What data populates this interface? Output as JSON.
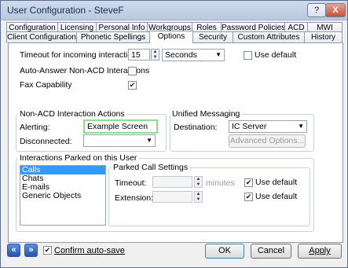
{
  "window": {
    "title": "User Configuration - SteveF",
    "help_label": "?",
    "close_label": "X"
  },
  "tabs_row1": [
    "Configuration",
    "Licensing",
    "Personal Info",
    "Workgroups",
    "Roles",
    "Password Policies",
    "ACD",
    "MWI"
  ],
  "tabs_row2": [
    "Client Configuration",
    "Phonetic Spellings",
    "Options",
    "Security",
    "Custom Attributes",
    "History"
  ],
  "active_tab": "Options",
  "options": {
    "timeout_label": "Timeout for incoming interactions:",
    "timeout_value": "15",
    "timeout_unit": "Seconds",
    "use_default_label": "Use default",
    "auto_answer_label": "Auto-Answer Non-ACD Interactions",
    "fax_label": "Fax Capability",
    "fax_checked": true,
    "auto_answer_checked": false,
    "use_default_checked": false
  },
  "non_acd": {
    "title": "Non-ACD Interaction Actions",
    "alerting_label": "Alerting:",
    "alerting_value": "Example Screen Pop",
    "disconnected_label": "Disconnected:",
    "disconnected_value": ""
  },
  "unified": {
    "title": "Unified Messaging",
    "destination_label": "Destination:",
    "destination_value": "IC Server",
    "advanced_label": "Advanced Options..."
  },
  "parked": {
    "title": "Interactions Parked on this User",
    "types": [
      "Calls",
      "Chats",
      "E-mails",
      "Generic Objects"
    ],
    "selected": "Calls",
    "settings_title": "Parked Call Settings",
    "timeout_label": "Timeout:",
    "minutes_label": "minutes",
    "extension_label": "Extension:",
    "use_default_label": "Use default",
    "timeout_use_default": true,
    "extension_use_default": true
  },
  "footer": {
    "back_label": "«",
    "forward_label": "»",
    "confirm_label": "Confirm auto-save",
    "confirm_checked": true,
    "ok_label": "OK",
    "cancel_label": "Cancel",
    "apply_label": "Apply"
  }
}
